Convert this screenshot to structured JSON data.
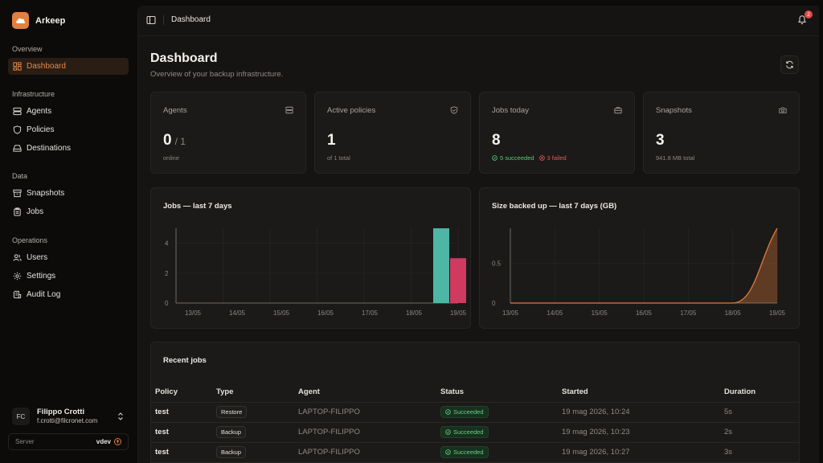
{
  "brand": {
    "name": "Arkeep"
  },
  "sidebar": {
    "sections": [
      {
        "label": "Overview"
      },
      {
        "label": "Infrastructure"
      },
      {
        "label": "Data"
      },
      {
        "label": "Operations"
      }
    ],
    "items": [
      {
        "label": "Dashboard",
        "icon": "dashboard-icon",
        "active": true
      },
      {
        "label": "Agents",
        "icon": "server-icon"
      },
      {
        "label": "Policies",
        "icon": "shield-icon"
      },
      {
        "label": "Destinations",
        "icon": "hard-drive-icon"
      },
      {
        "label": "Snapshots",
        "icon": "archive-icon"
      },
      {
        "label": "Jobs",
        "icon": "clipboard-icon"
      },
      {
        "label": "Users",
        "icon": "users-icon"
      },
      {
        "label": "Settings",
        "icon": "gear-icon"
      },
      {
        "label": "Audit Log",
        "icon": "log-icon"
      }
    ],
    "user": {
      "initials": "FC",
      "name": "Filippo Crotti",
      "email": "f.crotti@filcronet.com"
    },
    "server": {
      "label": "Server",
      "value": "vdev"
    }
  },
  "topbar": {
    "breadcrumb": "Dashboard",
    "notification_count": "2"
  },
  "page": {
    "title": "Dashboard",
    "subtitle": "Overview of your backup infrastructure."
  },
  "stats": {
    "agents": {
      "label": "Agents",
      "value": "0",
      "of": "/ 1",
      "foot": "online"
    },
    "policies": {
      "label": "Active policies",
      "value": "1",
      "foot": "of 1 total"
    },
    "jobs": {
      "label": "Jobs today",
      "value": "8",
      "succeeded": "5 succeeded",
      "failed": "3 failed"
    },
    "snapshots": {
      "label": "Snapshots",
      "value": "3",
      "foot": "941.8 MB total"
    }
  },
  "chart_data": [
    {
      "type": "bar",
      "title": "Jobs — last 7 days",
      "categories": [
        "13/05",
        "14/05",
        "15/05",
        "16/05",
        "17/05",
        "18/05",
        "19/05"
      ],
      "series": [
        {
          "values": [
            0,
            0,
            0,
            0,
            0,
            0,
            5
          ],
          "color": "#4db6a4"
        },
        {
          "values": [
            0,
            0,
            0,
            0,
            0,
            0,
            3
          ],
          "color": "#cf3a5e"
        }
      ],
      "yticks": [
        "0",
        "2",
        "4"
      ],
      "ylim": [
        0,
        5
      ],
      "grid": true
    },
    {
      "type": "area",
      "title": "Size backed up — last 7 days (GB)",
      "categories": [
        "13/05",
        "14/05",
        "15/05",
        "16/05",
        "17/05",
        "18/05",
        "19/05"
      ],
      "values": [
        0,
        0,
        0,
        0,
        0,
        0,
        0.94
      ],
      "yticks": [
        "0",
        "0.5"
      ],
      "ylim": [
        0,
        0.94
      ],
      "color": "#e07b3d",
      "grid": true
    }
  ],
  "recent_jobs": {
    "title": "Recent jobs",
    "columns": [
      "Policy",
      "Type",
      "Agent",
      "Status",
      "Started",
      "Duration"
    ],
    "rows": [
      {
        "policy": "test",
        "type": "Restore",
        "agent": "LAPTOP-FILIPPO",
        "status": "Succeeded",
        "started": "19 mag 2026, 10:24",
        "duration": "5s"
      },
      {
        "policy": "test",
        "type": "Backup",
        "agent": "LAPTOP-FILIPPO",
        "status": "Succeeded",
        "started": "19 mag 2026, 10:23",
        "duration": "2s"
      },
      {
        "policy": "test",
        "type": "Backup",
        "agent": "LAPTOP-FILIPPO",
        "status": "Succeeded",
        "started": "19 mag 2026, 10:27",
        "duration": "3s"
      }
    ]
  }
}
